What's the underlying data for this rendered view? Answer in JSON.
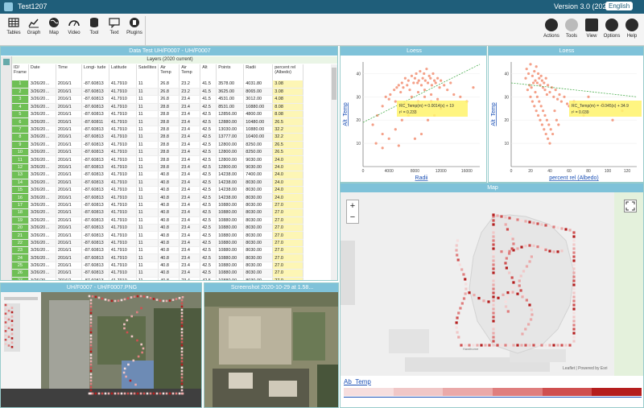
{
  "app": {
    "title": "Test1207",
    "version": "Version 3.0 (2021)",
    "language": "English"
  },
  "toolbar": {
    "left": [
      {
        "label": "Tables",
        "icon": "table-icon"
      },
      {
        "label": "Graph",
        "icon": "line-graph-icon"
      },
      {
        "label": "Map",
        "icon": "globe-icon"
      },
      {
        "label": "Video",
        "icon": "gauge-icon"
      },
      {
        "label": "Tool",
        "icon": "database-icon"
      },
      {
        "label": "Text",
        "icon": "chat-icon"
      },
      {
        "label": "Plugins",
        "icon": "plugin-icon"
      }
    ],
    "right": [
      {
        "label": "Actions",
        "icon": "circle-down-icon"
      },
      {
        "label": "Tools",
        "icon": "gear-icon"
      },
      {
        "label": "View",
        "icon": "monitor-icon"
      },
      {
        "label": "Options",
        "icon": "options-icon"
      },
      {
        "label": "Help",
        "icon": "help-icon"
      }
    ]
  },
  "data_table": {
    "title": "Data Test UH/F0007 - UH/F0007",
    "subtitle": "Layers (2020 current)",
    "columns": [
      "ID/ Frame",
      "Date",
      "Time",
      "Longi- tude",
      "Latitude",
      "Satellites",
      "Air Temp",
      "Air Temp",
      "Alt",
      "Points",
      "Radii",
      "percent rel (Albedo)"
    ],
    "rows": [
      [
        "1",
        "3/26/20…",
        "2016/1",
        "-87.60813",
        "41.7910",
        "11",
        "26.8",
        "23.2",
        "41.5",
        "3578.00",
        "4031.80",
        "3.08"
      ],
      [
        "2",
        "3/26/20…",
        "2016/1",
        "-87.60813",
        "41.7910",
        "11",
        "26.8",
        "23.2",
        "41.5",
        "3625.00",
        "8065.00",
        "3.08"
      ],
      [
        "3",
        "3/26/20…",
        "2016/1",
        "-87.60813",
        "41.7910",
        "11",
        "26.8",
        "23.4",
        "41.5",
        "4531.00",
        "3012.00",
        "4.08"
      ],
      [
        "4",
        "3/26/20…",
        "2016/1",
        "-87.60813",
        "41.7910",
        "11",
        "28.8",
        "23.4",
        "42.5",
        "8531.00",
        "10880.00",
        "8.08"
      ],
      [
        "5",
        "3/26/20…",
        "2016/1",
        "-87.60813",
        "41.7910",
        "11",
        "28.8",
        "23.4",
        "42.5",
        "12856.00",
        "4800.00",
        "8.08"
      ],
      [
        "6",
        "3/26/20…",
        "2016/1",
        "-87.60811",
        "41.7910",
        "11",
        "28.8",
        "23.4",
        "42.5",
        "12880.00",
        "10480.00",
        "26.5"
      ],
      [
        "7",
        "3/26/20…",
        "2016/1",
        "-87.60813",
        "41.7910",
        "11",
        "28.8",
        "23.4",
        "42.5",
        "13030.00",
        "10880.00",
        "32.2"
      ],
      [
        "8",
        "3/26/20…",
        "2016/1",
        "-87.60813",
        "41.7910",
        "11",
        "28.8",
        "23.4",
        "42.5",
        "13777.00",
        "10400.00",
        "32.2"
      ],
      [
        "9",
        "3/26/20…",
        "2016/1",
        "-87.60813",
        "41.7910",
        "11",
        "28.8",
        "23.4",
        "42.5",
        "12800.00",
        "8250.00",
        "26.5"
      ],
      [
        "10",
        "3/26/20…",
        "2016/1",
        "-87.60813",
        "41.7910",
        "11",
        "28.8",
        "23.4",
        "42.5",
        "12800.00",
        "8250.00",
        "26.5"
      ],
      [
        "11",
        "3/26/20…",
        "2016/1",
        "-87.60813",
        "41.7910",
        "11",
        "28.8",
        "23.4",
        "42.5",
        "12800.00",
        "9030.00",
        "24.0"
      ],
      [
        "12",
        "3/26/20…",
        "2016/1",
        "-87.60813",
        "41.7910",
        "11",
        "28.8",
        "23.4",
        "42.5",
        "12800.00",
        "9030.00",
        "24.0"
      ],
      [
        "13",
        "3/26/20…",
        "2016/1",
        "-87.60813",
        "41.7910",
        "11",
        "40.8",
        "23.4",
        "42.5",
        "14238.00",
        "7400.00",
        "24.0"
      ],
      [
        "14",
        "3/26/20…",
        "2016/1",
        "-87.60813",
        "41.7910",
        "11",
        "40.8",
        "23.4",
        "42.5",
        "14238.00",
        "8030.00",
        "24.0"
      ],
      [
        "15",
        "3/26/20…",
        "2016/1",
        "-87.60813",
        "41.7910",
        "11",
        "40.8",
        "23.4",
        "42.5",
        "14238.00",
        "8030.00",
        "24.0"
      ],
      [
        "16",
        "3/26/20…",
        "2016/1",
        "-87.60813",
        "41.7910",
        "11",
        "40.8",
        "23.4",
        "42.5",
        "14238.00",
        "8030.00",
        "24.0"
      ],
      [
        "17",
        "3/26/20…",
        "2016/1",
        "-87.60813",
        "41.7910",
        "11",
        "40.8",
        "23.4",
        "42.5",
        "10880.00",
        "8030.00",
        "27.0"
      ],
      [
        "18",
        "3/26/20…",
        "2016/1",
        "-87.60813",
        "41.7910",
        "11",
        "40.8",
        "23.4",
        "42.5",
        "10880.00",
        "8030.00",
        "27.0"
      ],
      [
        "19",
        "3/26/20…",
        "2016/1",
        "-87.60813",
        "41.7910",
        "11",
        "40.8",
        "23.4",
        "42.5",
        "10880.00",
        "8030.00",
        "27.0"
      ],
      [
        "20",
        "3/26/20…",
        "2016/1",
        "-87.60813",
        "41.7910",
        "11",
        "40.8",
        "23.4",
        "42.5",
        "10880.00",
        "8030.00",
        "27.0"
      ],
      [
        "21",
        "3/26/20…",
        "2016/1",
        "-87.60813",
        "41.7910",
        "11",
        "40.8",
        "23.4",
        "42.5",
        "10880.00",
        "8030.00",
        "27.0"
      ],
      [
        "22",
        "3/26/20…",
        "2016/1",
        "-87.60813",
        "41.7910",
        "11",
        "40.8",
        "23.4",
        "42.5",
        "10880.00",
        "8030.00",
        "27.0"
      ],
      [
        "23",
        "3/26/20…",
        "2016/1",
        "-87.60813",
        "41.7910",
        "11",
        "40.8",
        "23.4",
        "42.5",
        "10880.00",
        "8030.00",
        "27.0"
      ],
      [
        "24",
        "3/26/20…",
        "2016/1",
        "-87.60813",
        "41.7910",
        "11",
        "40.8",
        "23.4",
        "42.5",
        "10880.00",
        "8030.00",
        "27.0"
      ],
      [
        "25",
        "3/26/20…",
        "2016/1",
        "-87.60813",
        "41.7910",
        "11",
        "40.8",
        "23.4",
        "42.5",
        "10880.00",
        "8030.00",
        "27.0"
      ],
      [
        "26",
        "3/26/20…",
        "2016/1",
        "-87.60813",
        "41.7910",
        "11",
        "40.8",
        "23.4",
        "42.5",
        "10880.00",
        "8030.00",
        "27.0"
      ],
      [
        "27",
        "3/26/20…",
        "2016/1",
        "-87.60813",
        "41.7910",
        "11",
        "40.8",
        "23.4",
        "42.5",
        "10880.00",
        "8030.00",
        "27.0"
      ]
    ]
  },
  "chart_data": [
    {
      "type": "scatter",
      "title": "Loess",
      "xlabel": "Radii",
      "ylabel": "Alt_Temp",
      "xlim": [
        0,
        18000
      ],
      "ylim": [
        0,
        45
      ],
      "xticks": [
        "0",
        "4000",
        "8000",
        "12000",
        "16000"
      ],
      "yticks": [
        "10",
        "20",
        "30",
        "40"
      ],
      "annotation": [
        "RC_Temp(m) = 0.0014(x) + 19",
        "r² = 0.233"
      ],
      "trend": [
        [
          0,
          19
        ],
        [
          18000,
          44
        ]
      ],
      "points": [
        [
          1500,
          18
        ],
        [
          2200,
          22
        ],
        [
          3000,
          26
        ],
        [
          3500,
          30
        ],
        [
          4000,
          29
        ],
        [
          4200,
          31
        ],
        [
          4800,
          33
        ],
        [
          5000,
          28
        ],
        [
          5200,
          34
        ],
        [
          5500,
          35
        ],
        [
          5800,
          32
        ],
        [
          6000,
          36
        ],
        [
          6200,
          34
        ],
        [
          6500,
          38
        ],
        [
          6800,
          35
        ],
        [
          7000,
          37
        ],
        [
          7200,
          33
        ],
        [
          7500,
          39
        ],
        [
          7800,
          36
        ],
        [
          8000,
          38
        ],
        [
          8200,
          40
        ],
        [
          8400,
          36
        ],
        [
          8600,
          37
        ],
        [
          8800,
          41
        ],
        [
          9000,
          35
        ],
        [
          9200,
          38
        ],
        [
          9400,
          40
        ],
        [
          9600,
          37
        ],
        [
          9800,
          42
        ],
        [
          10000,
          36
        ],
        [
          10200,
          39
        ],
        [
          10400,
          38
        ],
        [
          10600,
          35
        ],
        [
          10800,
          40
        ],
        [
          11000,
          37
        ],
        [
          11200,
          36
        ],
        [
          11500,
          38
        ],
        [
          11800,
          34
        ],
        [
          12000,
          37
        ],
        [
          12500,
          35
        ],
        [
          13000,
          33
        ],
        [
          13500,
          36
        ],
        [
          14000,
          31
        ],
        [
          6000,
          20
        ],
        [
          7000,
          22
        ],
        [
          8000,
          24
        ],
        [
          9000,
          14
        ],
        [
          10000,
          20
        ],
        [
          11000,
          22
        ],
        [
          12000,
          25
        ],
        [
          5000,
          16
        ],
        [
          4000,
          12
        ],
        [
          3000,
          14
        ],
        [
          2000,
          10
        ],
        [
          7500,
          26
        ],
        [
          8500,
          28
        ],
        [
          9500,
          30
        ],
        [
          10500,
          28
        ],
        [
          11500,
          29
        ],
        [
          6500,
          27
        ],
        [
          7500,
          30
        ],
        [
          8500,
          32
        ],
        [
          9500,
          33
        ],
        [
          10500,
          31
        ],
        [
          3000,
          8
        ],
        [
          5500,
          9
        ],
        [
          8000,
          12
        ],
        [
          15000,
          30
        ],
        [
          16000,
          28
        ],
        [
          17000,
          34
        ]
      ]
    },
    {
      "type": "scatter",
      "title": "Loess",
      "xlabel": "percent rel (Albedo)",
      "ylabel": "Alt_Temp",
      "xlim": [
        0,
        130
      ],
      "ylim": [
        0,
        45
      ],
      "xticks": [
        "0",
        "20",
        "40",
        "60",
        "80",
        "100",
        "120"
      ],
      "yticks": [
        "10",
        "20",
        "30",
        "40"
      ],
      "annotation": [
        "RC_Temp(m) = -0.045(x) + 34.9",
        "r² = 0.039"
      ],
      "trend": [
        [
          0,
          36
        ],
        [
          130,
          30
        ]
      ],
      "points": [
        [
          15,
          38
        ],
        [
          16,
          42
        ],
        [
          18,
          40
        ],
        [
          20,
          44
        ],
        [
          22,
          39
        ],
        [
          24,
          41
        ],
        [
          25,
          37
        ],
        [
          26,
          43
        ],
        [
          27,
          36
        ],
        [
          28,
          40
        ],
        [
          29,
          38
        ],
        [
          30,
          35
        ],
        [
          31,
          39
        ],
        [
          32,
          37
        ],
        [
          33,
          34
        ],
        [
          34,
          36
        ],
        [
          35,
          33
        ],
        [
          36,
          38
        ],
        [
          37,
          31
        ],
        [
          38,
          35
        ],
        [
          40,
          32
        ],
        [
          42,
          34
        ],
        [
          44,
          30
        ],
        [
          46,
          33
        ],
        [
          48,
          29
        ],
        [
          50,
          31
        ],
        [
          52,
          28
        ],
        [
          55,
          30
        ],
        [
          58,
          27
        ],
        [
          60,
          26
        ],
        [
          20,
          30
        ],
        [
          22,
          28
        ],
        [
          24,
          26
        ],
        [
          26,
          24
        ],
        [
          28,
          22
        ],
        [
          30,
          20
        ],
        [
          32,
          18
        ],
        [
          34,
          16
        ],
        [
          36,
          14
        ],
        [
          38,
          12
        ],
        [
          40,
          10
        ],
        [
          25,
          32
        ],
        [
          27,
          30
        ],
        [
          29,
          28
        ],
        [
          31,
          26
        ],
        [
          33,
          24
        ],
        [
          35,
          22
        ],
        [
          37,
          20
        ],
        [
          39,
          18
        ],
        [
          41,
          16
        ],
        [
          43,
          14
        ],
        [
          45,
          24
        ],
        [
          47,
          20
        ],
        [
          49,
          18
        ],
        [
          21,
          34
        ],
        [
          23,
          36
        ],
        [
          19,
          35
        ],
        [
          17,
          33
        ],
        [
          65,
          28
        ],
        [
          70,
          25
        ],
        [
          75,
          22
        ],
        [
          80,
          30
        ],
        [
          95,
          27
        ],
        [
          105,
          20
        ],
        [
          115,
          24
        ]
      ]
    }
  ],
  "map": {
    "title": "Map",
    "legend_label": "Ab_Temp",
    "attribution": "Leaflet | Powered by Esri",
    "zoom_in": "+",
    "zoom_out": "−",
    "color_scale": [
      "#f6dede",
      "#f0c7c7",
      "#eaa9a9",
      "#df7e7e",
      "#cf4f4f",
      "#b51e1e"
    ]
  },
  "image_panels": [
    {
      "title": "UH/F0007 - UH/F0007.PNG"
    },
    {
      "title": "Screenshot 2020-10-29 at 1.58..."
    }
  ]
}
